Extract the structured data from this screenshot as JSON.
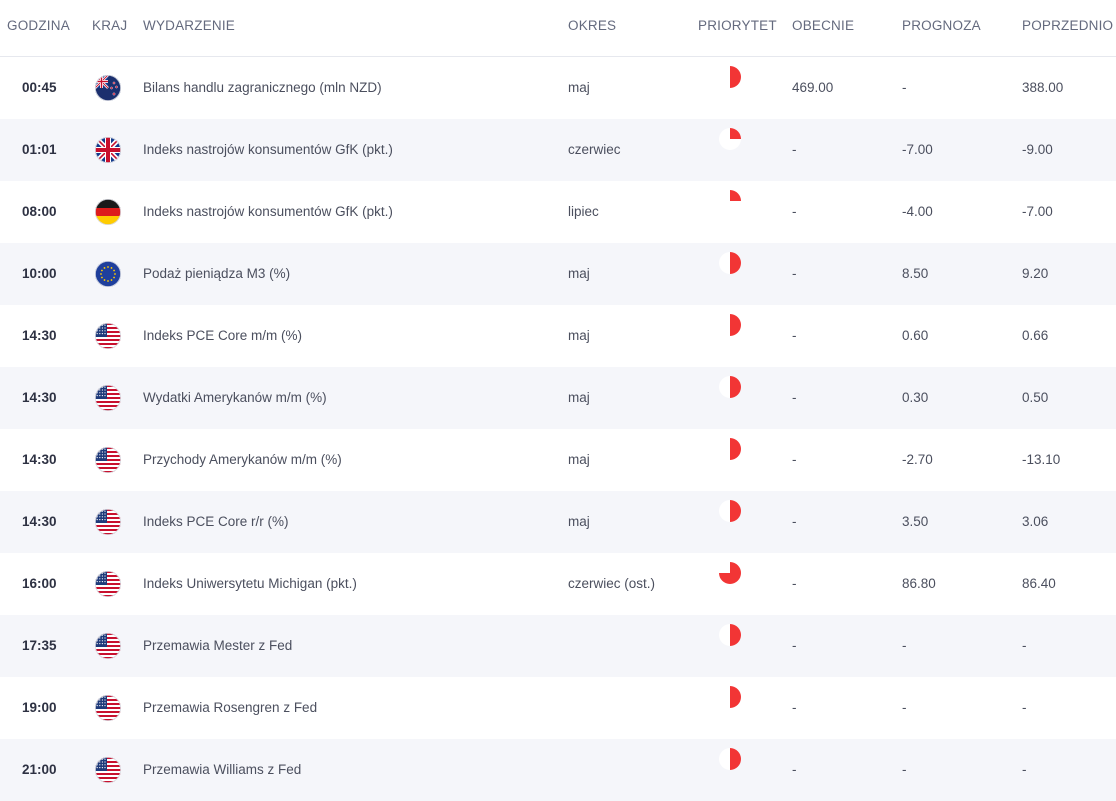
{
  "headers": {
    "time": "GODZINA",
    "country": "KRAJ",
    "event": "WYDARZENIE",
    "period": "OKRES",
    "priority": "PRIORYTET",
    "actual": "OBECNIE",
    "forecast": "PROGNOZA",
    "previous": "POPRZEDNIO"
  },
  "colors": {
    "priority": "#f23535",
    "priority_track": "#ffffff",
    "stripe": "#f5f6fa"
  },
  "rows": [
    {
      "time": "00:45",
      "country": "NZ",
      "flag": "nz-flag-icon",
      "event": "Bilans handlu zagranicznego (mln NZD)",
      "period": "maj",
      "priority": 0.5,
      "actual": "469.00",
      "forecast": "-",
      "previous": "388.00"
    },
    {
      "time": "01:01",
      "country": "UK",
      "flag": "uk-flag-icon",
      "event": "Indeks nastrojów konsumentów GfK (pkt.)",
      "period": "czerwiec",
      "priority": 0.25,
      "actual": "-",
      "forecast": "-7.00",
      "previous": "-9.00"
    },
    {
      "time": "08:00",
      "country": "DE",
      "flag": "de-flag-icon",
      "event": "Indeks nastrojów konsumentów GfK (pkt.)",
      "period": "lipiec",
      "priority": 0.25,
      "actual": "-",
      "forecast": "-4.00",
      "previous": "-7.00"
    },
    {
      "time": "10:00",
      "country": "EU",
      "flag": "eu-flag-icon",
      "event": "Podaż pieniądza M3 (%)",
      "period": "maj",
      "priority": 0.5,
      "actual": "-",
      "forecast": "8.50",
      "previous": "9.20"
    },
    {
      "time": "14:30",
      "country": "US",
      "flag": "us-flag-icon",
      "event": "Indeks PCE Core m/m (%)",
      "period": "maj",
      "priority": 0.5,
      "actual": "-",
      "forecast": "0.60",
      "previous": "0.66"
    },
    {
      "time": "14:30",
      "country": "US",
      "flag": "us-flag-icon",
      "event": "Wydatki Amerykanów m/m (%)",
      "period": "maj",
      "priority": 0.5,
      "actual": "-",
      "forecast": "0.30",
      "previous": "0.50"
    },
    {
      "time": "14:30",
      "country": "US",
      "flag": "us-flag-icon",
      "event": "Przychody Amerykanów m/m (%)",
      "period": "maj",
      "priority": 0.5,
      "actual": "-",
      "forecast": "-2.70",
      "previous": "-13.10"
    },
    {
      "time": "14:30",
      "country": "US",
      "flag": "us-flag-icon",
      "event": "Indeks PCE Core r/r (%)",
      "period": "maj",
      "priority": 0.5,
      "actual": "-",
      "forecast": "3.50",
      "previous": "3.06"
    },
    {
      "time": "16:00",
      "country": "US",
      "flag": "us-flag-icon",
      "event": "Indeks Uniwersytetu Michigan (pkt.)",
      "period": "czerwiec (ost.)",
      "priority": 0.75,
      "actual": "-",
      "forecast": "86.80",
      "previous": "86.40"
    },
    {
      "time": "17:35",
      "country": "US",
      "flag": "us-flag-icon",
      "event": "Przemawia Mester z Fed",
      "period": "",
      "priority": 0.5,
      "actual": "-",
      "forecast": "-",
      "previous": "-"
    },
    {
      "time": "19:00",
      "country": "US",
      "flag": "us-flag-icon",
      "event": "Przemawia Rosengren z Fed",
      "period": "",
      "priority": 0.5,
      "actual": "-",
      "forecast": "-",
      "previous": "-"
    },
    {
      "time": "21:00",
      "country": "US",
      "flag": "us-flag-icon",
      "event": "Przemawia Williams z Fed",
      "period": "",
      "priority": 0.5,
      "actual": "-",
      "forecast": "-",
      "previous": "-"
    }
  ]
}
